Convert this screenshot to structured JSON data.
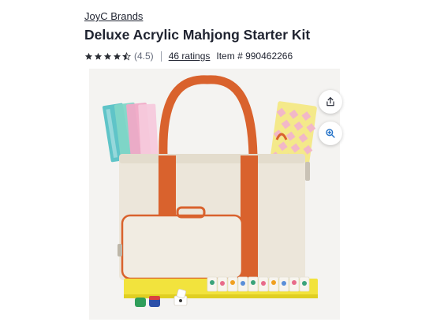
{
  "product": {
    "brand": "JoyC Brands",
    "title": "Deluxe Acrylic Mahjong Starter Kit",
    "rating_value": "(4.5)",
    "ratings_count": "46 ratings",
    "item_number": "Item # 990462266"
  },
  "rating": {
    "stars": 4.5,
    "max": 5
  },
  "colors": {
    "star": "#2a2d34",
    "accent_orange": "#d9622d",
    "bag_cream": "#ece6da",
    "tray_yellow": "#f2e33d",
    "zoom_icon": "#2472c8"
  },
  "icons": {
    "share": "share-icon",
    "zoom": "zoom-in-icon"
  }
}
